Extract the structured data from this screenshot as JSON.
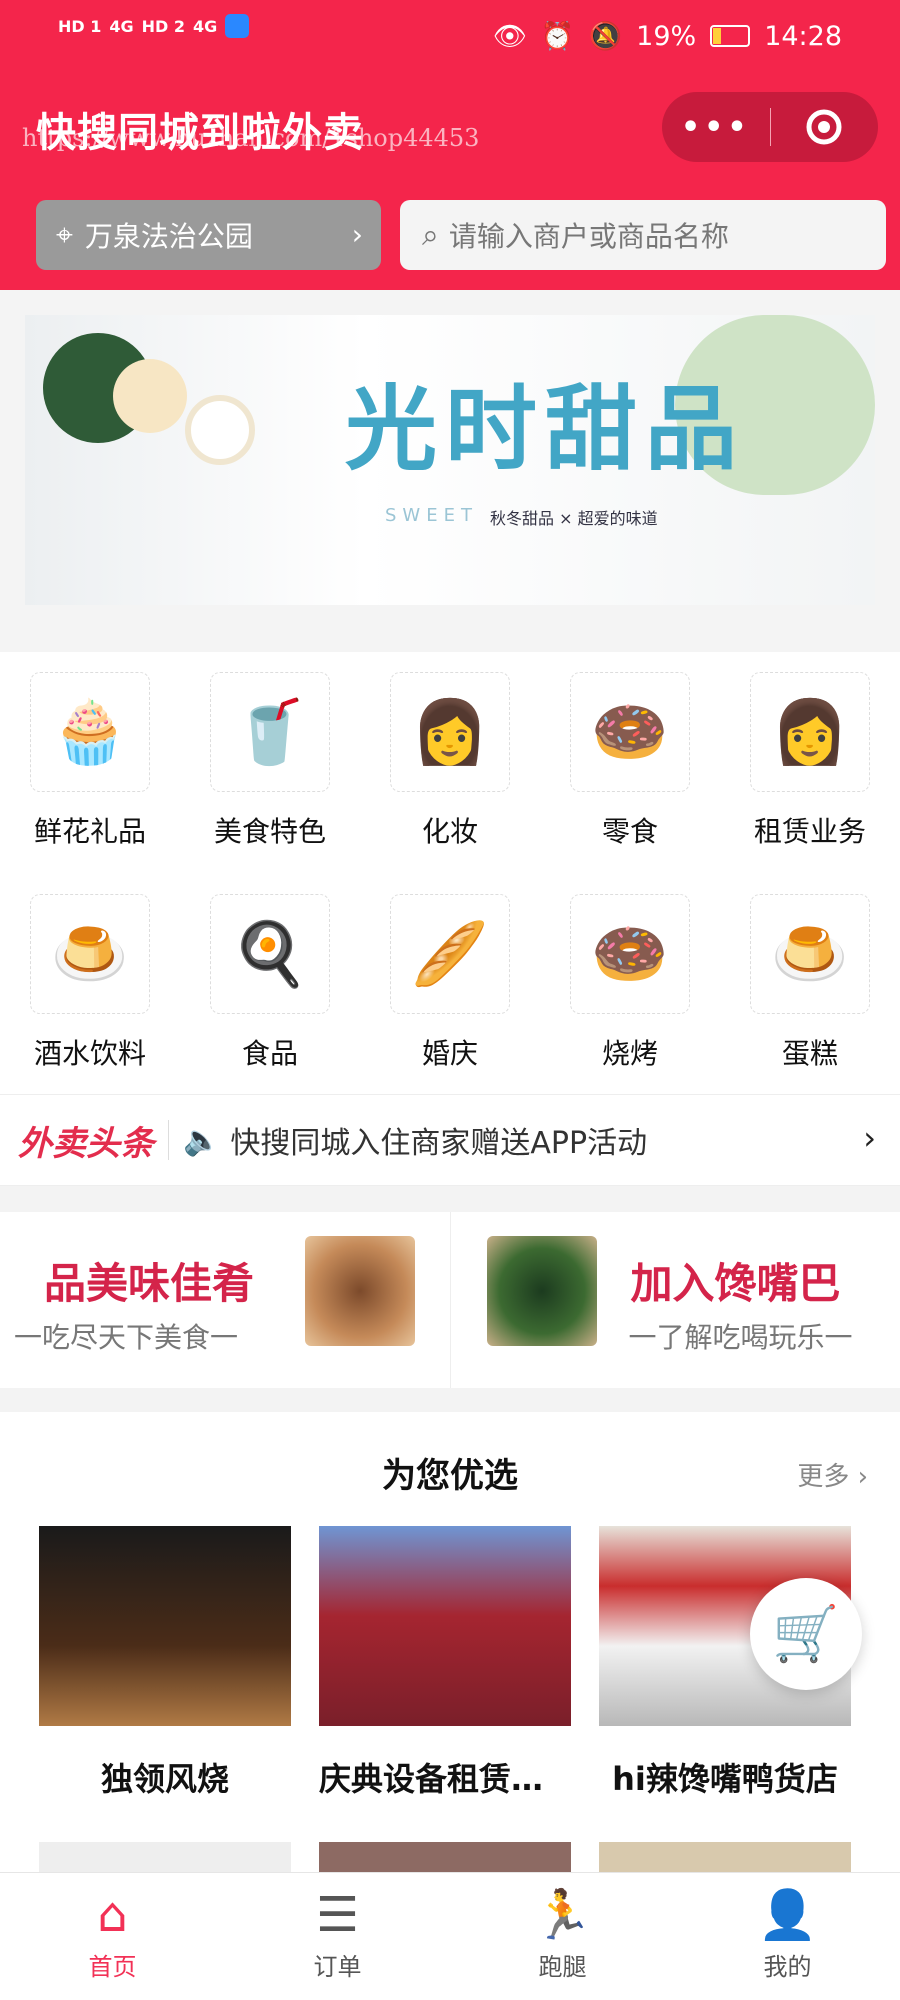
{
  "status": {
    "time": "14:28",
    "battery": "19%",
    "net1": "4G",
    "net2": "4G",
    "sim1": "HD 1",
    "sim2": "HD 2"
  },
  "header": {
    "title": "快搜同城到啦外卖",
    "watermark": "https://www.huzhan.com/1shop44453",
    "location": "万泉法治公园",
    "search_placeholder": "请输入商户或商品名称"
  },
  "banner": {
    "title": "光时甜品",
    "subtitle": "秋冬甜品 × 超爱的味道",
    "word": "SWEET"
  },
  "categories": [
    {
      "label": "鲜花礼品",
      "icon": "cupcake-icon"
    },
    {
      "label": "美食特色",
      "icon": "drink-icon"
    },
    {
      "label": "化妆",
      "icon": "woman-icon"
    },
    {
      "label": "零食",
      "icon": "donut-icon"
    },
    {
      "label": "租赁业务",
      "icon": "woman-icon"
    },
    {
      "label": "酒水饮料",
      "icon": "pudding-icon"
    },
    {
      "label": "食品",
      "icon": "egg-icon"
    },
    {
      "label": "婚庆",
      "icon": "bread-icon"
    },
    {
      "label": "烧烤",
      "icon": "donut-icon"
    },
    {
      "label": "蛋糕",
      "icon": "pudding-icon"
    }
  ],
  "news": {
    "brand": "外卖头条",
    "text": "快搜同城入住商家赠送APP活动"
  },
  "promos": [
    {
      "title": "品美味佳肴",
      "subtitle": "一吃尽天下美食一"
    },
    {
      "title": "加入馋嘴巴",
      "subtitle": "一了解吃喝玩乐一"
    }
  ],
  "recommend": {
    "title": "为您优选",
    "more": "更多",
    "items": [
      {
        "name": "独领风烧"
      },
      {
        "name": "庆典设备租赁《..."
      },
      {
        "name": "hi辣馋嘴鸭货店"
      }
    ]
  },
  "tabs": [
    {
      "label": "首页",
      "icon": "home-icon"
    },
    {
      "label": "订单",
      "icon": "list-icon"
    },
    {
      "label": "跑腿",
      "icon": "runner-icon"
    },
    {
      "label": "我的",
      "icon": "user-icon"
    }
  ]
}
